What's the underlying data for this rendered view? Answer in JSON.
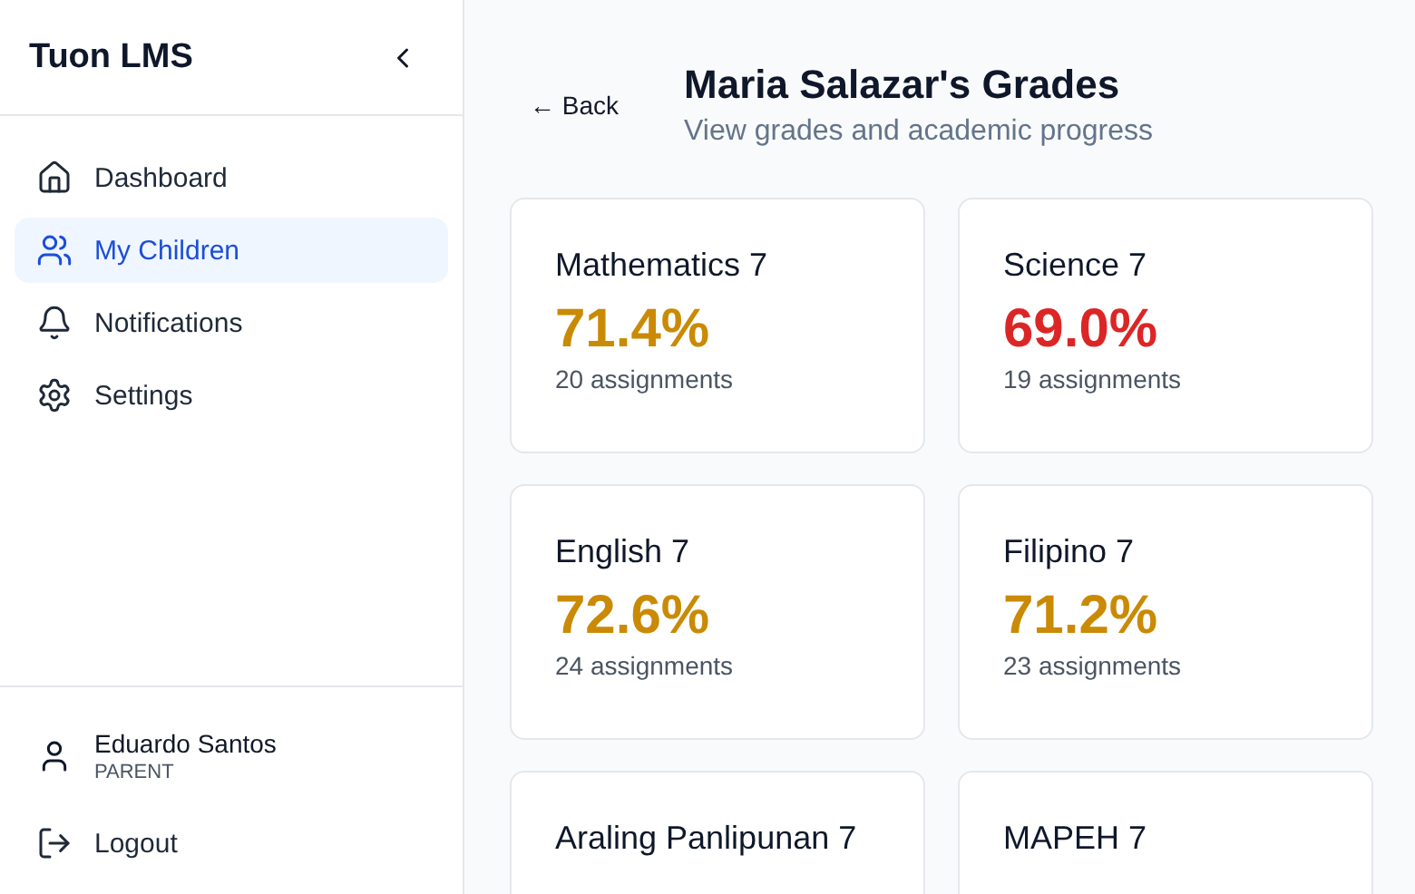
{
  "sidebar": {
    "brand": "Tuon LMS",
    "items": [
      {
        "label": "Dashboard",
        "selected": false
      },
      {
        "label": "My Children",
        "selected": true
      },
      {
        "label": "Notifications",
        "selected": false
      },
      {
        "label": "Settings",
        "selected": false
      }
    ],
    "user": {
      "name": "Eduardo Santos",
      "role": "PARENT"
    },
    "logout": "Logout"
  },
  "header": {
    "back": "← Back",
    "title": "Maria Salazar's Grades",
    "subtitle": "View grades and academic progress"
  },
  "cards": [
    {
      "subject": "Mathematics 7",
      "grade": "71.4%",
      "count": "20 assignments",
      "color": "#ca8a04"
    },
    {
      "subject": "Science 7",
      "grade": "69.0%",
      "count": "19 assignments",
      "color": "#dc2626"
    },
    {
      "subject": "English 7",
      "grade": "72.6%",
      "count": "24 assignments",
      "color": "#ca8a04"
    },
    {
      "subject": "Filipino 7",
      "grade": "71.2%",
      "count": "23 assignments",
      "color": "#ca8a04"
    },
    {
      "subject": "Araling Panlipunan 7"
    },
    {
      "subject": "MAPEH 7"
    }
  ]
}
